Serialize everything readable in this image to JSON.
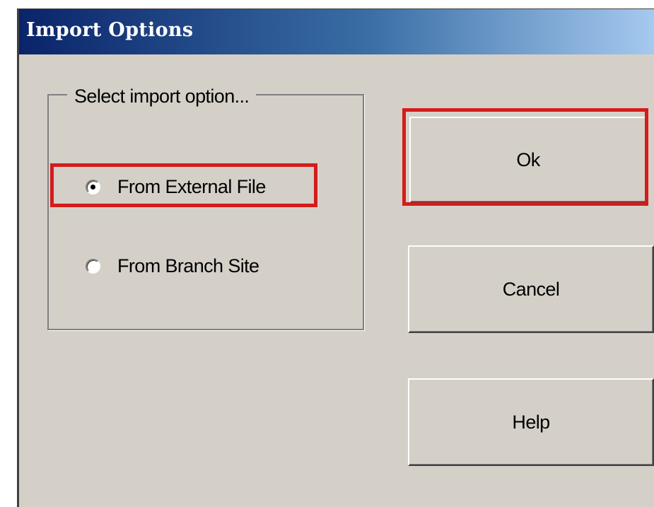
{
  "dialog": {
    "title": "Import Options",
    "group_label": "Select import option...",
    "options": [
      {
        "label": "From External File",
        "selected": true
      },
      {
        "label": "From Branch Site",
        "selected": false
      }
    ],
    "buttons": {
      "ok": "Ok",
      "cancel": "Cancel",
      "help": "Help"
    }
  },
  "colors": {
    "title_gradient": [
      "#0a246a",
      "#a6caf0"
    ],
    "dialog_bg": "#d4d0c8",
    "highlight": "#d41c1c"
  },
  "icons": {
    "radio_selected": "radio-selected-icon",
    "radio_unselected": "radio-unselected-icon"
  }
}
